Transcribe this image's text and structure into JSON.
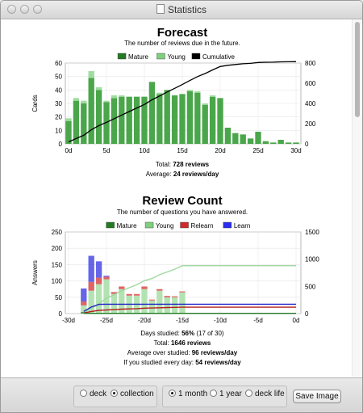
{
  "window": {
    "title": "Statistics"
  },
  "forecast": {
    "heading": "Forecast",
    "subheading": "The number of reviews due in the future.",
    "legend": [
      {
        "label": "Mature",
        "color": "#237a23"
      },
      {
        "label": "Young",
        "color": "#7fcf7f"
      },
      {
        "label": "Cumulative",
        "color": "#000000"
      }
    ],
    "ylabel": "Cards",
    "total_label": "Total: ",
    "total_value": "728 reviews",
    "average_label": "Average: ",
    "average_value": "24 reviews/day"
  },
  "reviews": {
    "heading": "Review Count",
    "subheading": "The number of questions you have answered.",
    "legend": [
      {
        "label": "Mature",
        "color": "#237a23"
      },
      {
        "label": "Young",
        "color": "#7fcf7f"
      },
      {
        "label": "Relearn",
        "color": "#d12a2a"
      },
      {
        "label": "Learn",
        "color": "#2c2cf0"
      }
    ],
    "ylabel": "Answers",
    "stats": [
      {
        "label": "Days studied: ",
        "value": "56%",
        "suffix": " (17 of 30)"
      },
      {
        "label": "Total: ",
        "value": "1646 reviews",
        "suffix": ""
      },
      {
        "label": "Average over studied: ",
        "value": "96 reviews/day",
        "suffix": ""
      },
      {
        "label": "If you studied every day: ",
        "value": "54 reviews/day",
        "suffix": ""
      }
    ]
  },
  "footer": {
    "scope_options": [
      {
        "label": "deck",
        "selected": false
      },
      {
        "label": "collection",
        "selected": true
      }
    ],
    "period_options": [
      {
        "label": "1 month",
        "selected": true
      },
      {
        "label": "1 year",
        "selected": false
      },
      {
        "label": "deck life",
        "selected": false
      }
    ],
    "save_label": "Save Image"
  },
  "chart_data": [
    {
      "type": "bar",
      "title": "Forecast",
      "subtitle": "The number of reviews due in the future.",
      "ylabel": "Cards",
      "x_ticks": [
        "0d",
        "5d",
        "10d",
        "15d",
        "20d",
        "25d",
        "30d"
      ],
      "y_ticks": [
        0,
        10,
        20,
        30,
        40,
        50,
        60
      ],
      "y2_ticks": [
        0,
        200,
        400,
        600,
        800
      ],
      "ylim": [
        0,
        60
      ],
      "y2lim": [
        0,
        800
      ],
      "x": [
        0,
        1,
        2,
        3,
        4,
        5,
        6,
        7,
        8,
        9,
        10,
        11,
        12,
        13,
        14,
        15,
        16,
        17,
        18,
        19,
        20,
        21,
        22,
        23,
        24,
        25,
        26,
        27,
        28,
        29,
        30
      ],
      "series": [
        {
          "name": "Mature",
          "values": [
            17,
            32,
            30,
            49,
            40,
            31,
            34,
            35,
            35,
            35,
            35,
            46,
            37,
            40,
            36,
            37,
            39,
            38,
            29,
            35,
            34,
            12,
            8,
            7,
            4,
            9,
            2,
            1,
            3,
            1,
            1
          ]
        },
        {
          "name": "Young",
          "values": [
            2,
            2,
            2,
            5,
            2,
            1,
            2,
            1,
            0,
            0,
            0,
            0,
            1,
            0,
            0,
            0,
            1,
            1,
            1,
            1,
            0,
            0,
            0,
            0,
            0,
            0,
            0,
            0,
            0,
            0,
            0
          ]
        },
        {
          "name": "Cumulative",
          "values": [
            19,
            53,
            85,
            139,
            181,
            213,
            249,
            285,
            320,
            355,
            390,
            436,
            474,
            514,
            550,
            587,
            627,
            666,
            696,
            732,
            766,
            778,
            786,
            793,
            797,
            806,
            808,
            809,
            812,
            813,
            814
          ]
        }
      ]
    },
    {
      "type": "bar",
      "title": "Review Count",
      "subtitle": "The number of questions you have answered.",
      "ylabel": "Answers",
      "x_ticks": [
        "-30d",
        "-25d",
        "-20d",
        "-15d",
        "-10d",
        "-5d",
        "0d"
      ],
      "y_ticks": [
        0,
        50,
        100,
        150,
        200,
        250
      ],
      "y2_ticks": [
        0,
        500,
        1000,
        1500
      ],
      "ylim": [
        0,
        250
      ],
      "y2lim": [
        0,
        1500
      ],
      "x": [
        -28,
        -27,
        -26,
        -25,
        -24,
        -23,
        -22,
        -21,
        -20,
        -19,
        -18,
        -17,
        -16,
        -15
      ],
      "series": [
        {
          "name": "Mature",
          "values": [
            5,
            0,
            0,
            0,
            0,
            0,
            0,
            0,
            0,
            0,
            0,
            0,
            0,
            0
          ]
        },
        {
          "name": "Young",
          "values": [
            20,
            70,
            90,
            105,
            60,
            75,
            55,
            55,
            75,
            40,
            70,
            50,
            50,
            65
          ]
        },
        {
          "name": "Relearn",
          "values": [
            12,
            27,
            20,
            8,
            6,
            8,
            5,
            5,
            8,
            3,
            5,
            4,
            3,
            3
          ]
        },
        {
          "name": "Learn",
          "values": [
            40,
            80,
            50,
            3,
            0,
            0,
            0,
            0,
            0,
            0,
            0,
            0,
            0,
            0
          ]
        }
      ]
    }
  ]
}
